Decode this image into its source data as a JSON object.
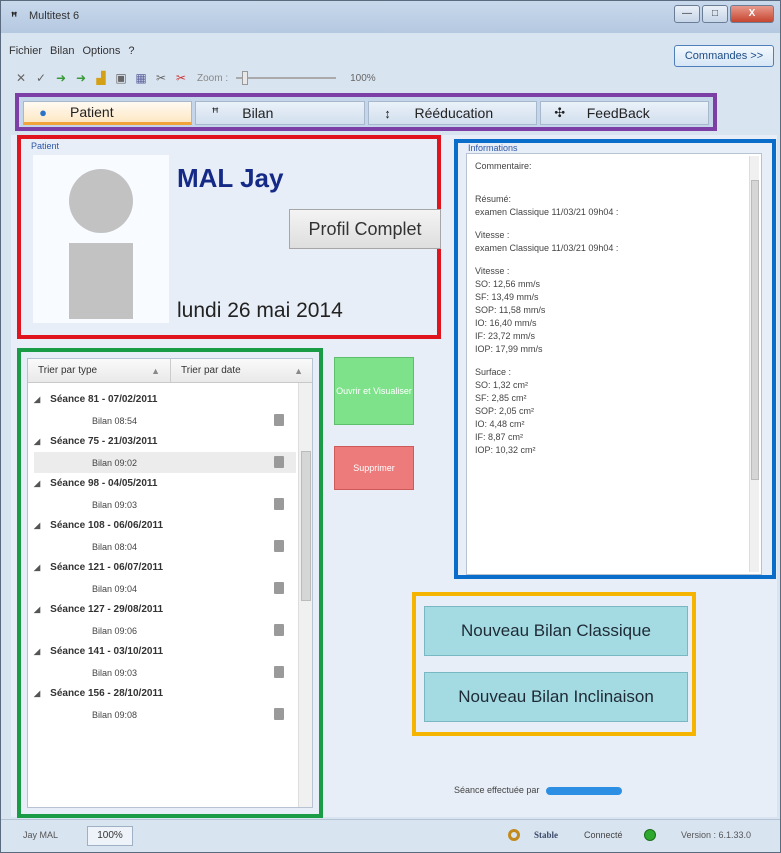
{
  "window": {
    "title": "Multitest 6",
    "app_icon": "ꟸ",
    "minimize": "—",
    "maximize": "□",
    "close": "X"
  },
  "menu": [
    "Fichier",
    "Bilan",
    "Options",
    "?"
  ],
  "commands_button": "Commandes >>",
  "toolbar": {
    "icons": [
      "pin-icon",
      "check-icon",
      "green-arrow-icon",
      "green-arrow-icon",
      "chart-icon",
      "printer-icon",
      "export-icon",
      "scissors-icon",
      "scissors-red-icon"
    ],
    "zoom_label": "Zoom :",
    "zoom_value": "100%",
    "zoom_level": 0.06
  },
  "tabs": [
    {
      "label": "Patient",
      "icon": "person-icon",
      "glyph": "●"
    },
    {
      "label": "Bilan",
      "icon": "feet-icon",
      "glyph": "ꟸ"
    },
    {
      "label": "Rééducation",
      "icon": "exercise-icon",
      "glyph": "↕"
    },
    {
      "label": "FeedBack",
      "icon": "feedback-icon",
      "glyph": "✣"
    }
  ],
  "patient": {
    "group_label": "Patient",
    "name": "MAL Jay",
    "profile_button": "Profil Complet",
    "date": "lundi 26 mai 2014"
  },
  "informations": {
    "group_label": "Informations",
    "lines": [
      "Commentaire:",
      "",
      "",
      "Résumé:",
      "examen Classique 11/03/21 09h04 :",
      "",
      "Vitesse :",
      "examen Classique 11/03/21 09h04 :",
      "",
      "Vitesse :",
      "SO: 12,56 mm/s",
      "SF: 13,49 mm/s",
      "SOP: 11,58 mm/s",
      "IO: 16,40 mm/s",
      "IF: 23,72 mm/s",
      "IOP: 17,99 mm/s",
      "",
      "Surface :",
      "SO: 1,32 cm²",
      "SF: 2,85 cm²",
      "SOP: 2,05 cm²",
      "IO: 4,48 cm²",
      "IF: 8,87 cm²",
      "IOP: 10,32 cm²"
    ]
  },
  "list": {
    "sort_type": "Trier par type",
    "sort_date": "Trier par date",
    "sessions": [
      {
        "title": "Séance 81 - 07/02/2011",
        "bilan": "Bilan 08:54",
        "selected": false
      },
      {
        "title": "Séance 75 - 21/03/2011",
        "bilan": "Bilan 09:02",
        "selected": true
      },
      {
        "title": "Séance 98 - 04/05/2011",
        "bilan": "Bilan 09:03",
        "selected": false
      },
      {
        "title": "Séance 108 - 06/06/2011",
        "bilan": "Bilan 08:04",
        "selected": false
      },
      {
        "title": "Séance 121 - 06/07/2011",
        "bilan": "Bilan 09:04",
        "selected": false
      },
      {
        "title": "Séance 127 - 29/08/2011",
        "bilan": "Bilan 09:06",
        "selected": false
      },
      {
        "title": "Séance 141 - 03/10/2011",
        "bilan": "Bilan 09:03",
        "selected": false
      },
      {
        "title": "Séance 156 - 28/10/2011",
        "bilan": "Bilan 09:08",
        "selected": false
      }
    ]
  },
  "actions": {
    "open": "Ouvrir et Visualiser",
    "delete": "Supprimer"
  },
  "new_bilan": {
    "classic": "Nouveau Bilan Classique",
    "inclination": "Nouveau Bilan Inclinaison"
  },
  "seance_by": "Séance effectuée par",
  "status": {
    "user": "Jay MAL",
    "zoom": "100%",
    "stable": "Stable",
    "connected": "Connecté",
    "version": "Version : 6.1.33.0"
  },
  "colors": {
    "tabs_frame": "#7b3fa6",
    "patient_frame": "#e0141e",
    "info_frame": "#0a6dc9",
    "list_frame": "#1a9c46",
    "new_frame": "#f4b400",
    "open_button": "#7de28a",
    "delete_button": "#ee7b7b",
    "new_button": "#a4dbe2"
  }
}
